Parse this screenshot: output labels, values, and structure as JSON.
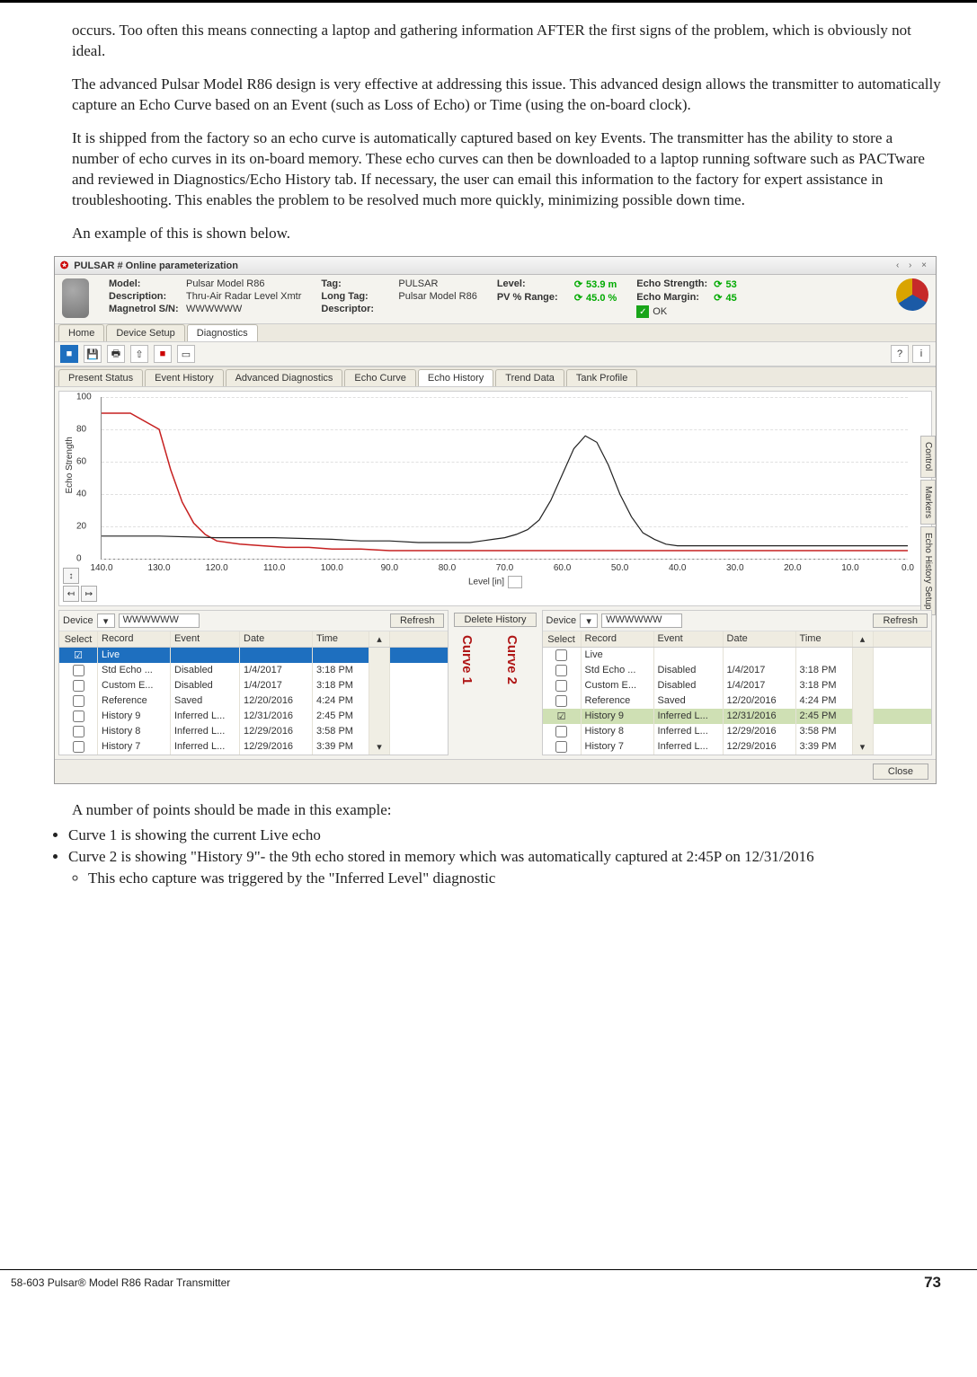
{
  "paragraphs": {
    "p1": "occurs. Too often this means connecting a laptop and gathering information AFTER the first signs of the problem, which is obviously not ideal.",
    "p2": "The advanced Pulsar Model R86 design is very effective at addressing this issue. This advanced design allows the transmitter to automatically capture an Echo Curve based on an Event (such as Loss of Echo) or Time (using the on-board clock).",
    "p3": "It is shipped from the factory so an echo curve is automatically captured based on key Events. The transmitter has the ability to store a number of echo curves in its on-board memory. These echo curves can then be downloaded to a laptop running software such as PACTware and reviewed in Diagnostics/Echo History tab.  If necessary, the user can email this information to the factory for expert assistance in troubleshooting. This enables the problem to be resolved much more quickly, minimizing possible down time.",
    "p4": "An example of this is shown below."
  },
  "window": {
    "title": "PULSAR # Online parameterization",
    "controls": "‹ › ×"
  },
  "header": {
    "model_lbl": "Model:",
    "model_val": "Pulsar Model R86",
    "desc_lbl": "Description:",
    "desc_val": "Thru-Air Radar Level Xmtr",
    "sn_lbl": "Magnetrol S/N:",
    "sn_val": "WWWWWW",
    "tag_lbl": "Tag:",
    "tag_val": "PULSAR",
    "longtag_lbl": "Long Tag:",
    "longtag_val": "Pulsar Model R86",
    "descr_lbl": "Descriptor:",
    "level_lbl": "Level:",
    "level_val": "53.9 m",
    "pvrange_lbl": "PV % Range:",
    "pvrange_val": "45.0 %",
    "echostr_lbl": "Echo Strength:",
    "echostr_val": "53",
    "echomar_lbl": "Echo Margin:",
    "echomar_val": "45",
    "ok": "OK"
  },
  "top_tabs": [
    "Home",
    "Device Setup",
    "Diagnostics"
  ],
  "sub_tabs": [
    "Present Status",
    "Event History",
    "Advanced Diagnostics",
    "Echo Curve",
    "Echo History",
    "Trend Data",
    "Tank Profile"
  ],
  "side_tabs": [
    "Control",
    "Markers",
    "Echo History Setup"
  ],
  "chart_data": {
    "type": "line",
    "ylabel": "Echo Strength",
    "xlabel": "Level [in]",
    "x_ticks": [
      140.0,
      130.0,
      120.0,
      110.0,
      100.0,
      90.0,
      80.0,
      70.0,
      60.0,
      50.0,
      40.0,
      30.0,
      20.0,
      10.0,
      0.0
    ],
    "y_ticks": [
      0,
      20,
      40,
      60,
      80,
      100
    ],
    "xlim": [
      140,
      0
    ],
    "ylim": [
      0,
      100
    ],
    "series": [
      {
        "name": "Curve 1 (Live)",
        "color": "#c62020",
        "x": [
          140,
          135,
          130,
          128,
          126,
          124,
          122,
          120,
          116,
          112,
          108,
          104,
          100,
          95,
          90,
          80,
          70,
          60,
          50,
          40,
          30,
          20,
          10,
          0
        ],
        "y": [
          90,
          90,
          80,
          55,
          35,
          22,
          15,
          11,
          9,
          8,
          7,
          7,
          6,
          6,
          5,
          5,
          5,
          5,
          5,
          5,
          5,
          5,
          5,
          5
        ]
      },
      {
        "name": "Curve 2 (History 9)",
        "color": "#222",
        "x": [
          140,
          130,
          120,
          110,
          100,
          95,
          90,
          85,
          80,
          78,
          76,
          74,
          72,
          70,
          68,
          66,
          64,
          62,
          60,
          58,
          56,
          54,
          52,
          50,
          48,
          46,
          44,
          42,
          40,
          30,
          20,
          10,
          0
        ],
        "y": [
          14,
          14,
          13,
          13,
          12,
          11,
          11,
          10,
          10,
          10,
          10,
          11,
          12,
          13,
          15,
          18,
          24,
          36,
          52,
          68,
          76,
          72,
          58,
          40,
          26,
          16,
          12,
          9,
          8,
          8,
          8,
          8,
          8
        ]
      }
    ]
  },
  "list_labels": {
    "device": "Device",
    "refresh": "Refresh",
    "delete": "Delete History",
    "cols": {
      "sel": "Select",
      "rec": "Record",
      "ev": "Event",
      "dt": "Date",
      "tm": "Time"
    },
    "curve1": "Curve 1",
    "curve2": "Curve 2"
  },
  "device_vals": {
    "d1": "WWWWWW",
    "d2": "WWWWWW"
  },
  "records": [
    {
      "rec": "Live",
      "ev": "",
      "dt": "",
      "tm": ""
    },
    {
      "rec": "Std Echo ...",
      "ev": "Disabled",
      "dt": "1/4/2017",
      "tm": "3:18 PM"
    },
    {
      "rec": "Custom E...",
      "ev": "Disabled",
      "dt": "1/4/2017",
      "tm": "3:18 PM"
    },
    {
      "rec": "Reference",
      "ev": "Saved",
      "dt": "12/20/2016",
      "tm": "4:24 PM"
    },
    {
      "rec": "History 9",
      "ev": "Inferred L...",
      "dt": "12/31/2016",
      "tm": "2:45 PM"
    },
    {
      "rec": "History 8",
      "ev": "Inferred L...",
      "dt": "12/29/2016",
      "tm": "3:58 PM"
    },
    {
      "rec": "History 7",
      "ev": "Inferred L...",
      "dt": "12/29/2016",
      "tm": "3:39 PM"
    }
  ],
  "close_btn": "Close",
  "after": {
    "lead": "A number of points should be made in this example:",
    "b1": "Curve 1 is showing the current Live echo",
    "b2": "Curve 2 is showing \"History 9\"- the 9th echo stored in memory which was automatically captured at 2:45P on 12/31/2016",
    "b2a": "This echo capture was triggered by the \"Inferred Level\" diagnostic"
  },
  "footer": {
    "left": "58-603 Pulsar® Model R86 Radar Transmitter",
    "page": "73"
  }
}
